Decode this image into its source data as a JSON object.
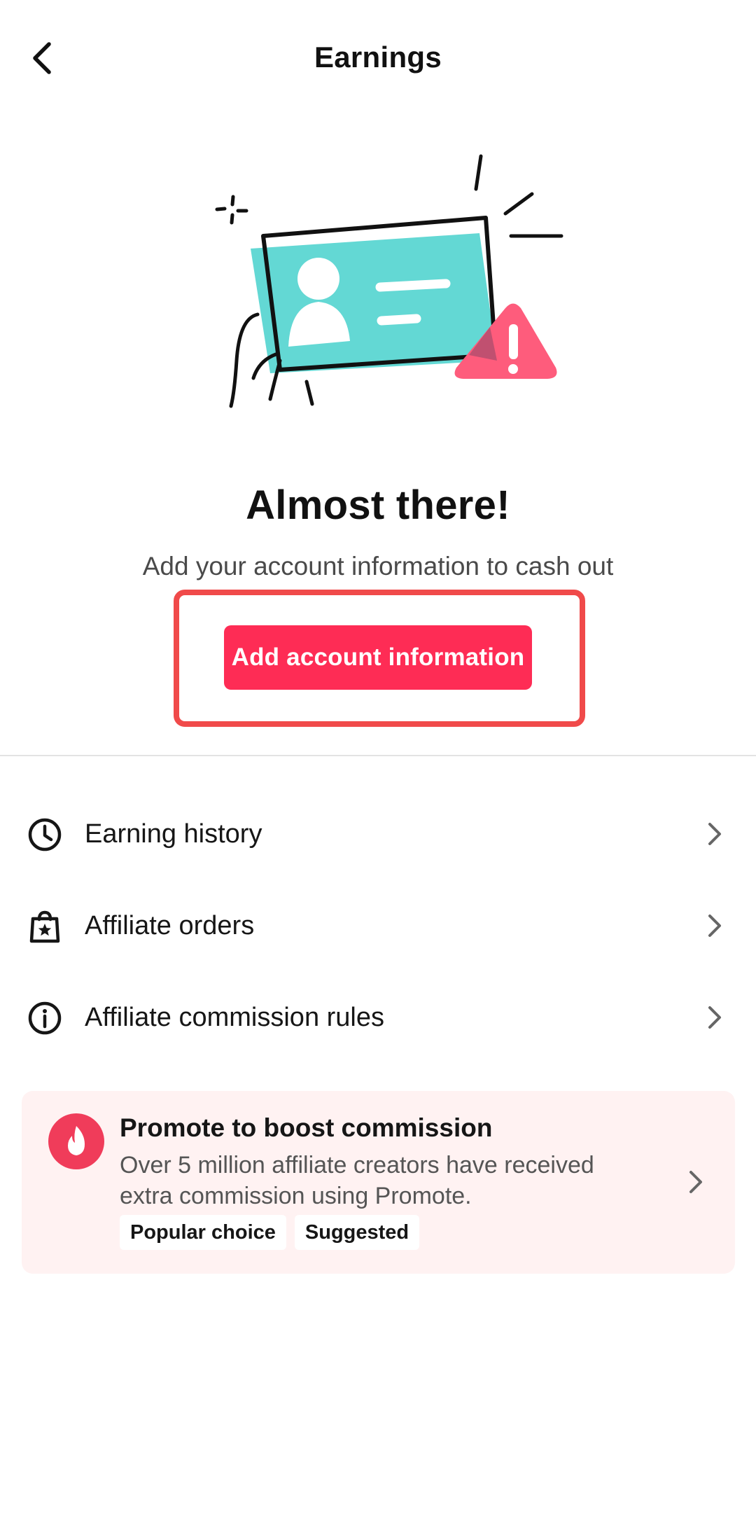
{
  "header": {
    "title": "Earnings",
    "back_icon": "chevron-left-icon"
  },
  "hero": {
    "headline": "Almost there!",
    "subtext": "Add your account information to cash out",
    "button_label": "Add account information",
    "illustration": "id-card-warning-illustration"
  },
  "menu": {
    "items": [
      {
        "label": "Earning history",
        "icon": "clock-icon"
      },
      {
        "label": "Affiliate orders",
        "icon": "shopping-bag-star-icon"
      },
      {
        "label": "Affiliate commission rules",
        "icon": "info-icon"
      }
    ]
  },
  "promo": {
    "title": "Promote to boost commission",
    "description": "Over 5 million affiliate creators have received extra commission using Promote.",
    "tags": [
      "Popular choice",
      "Suggested"
    ],
    "icon": "flame-icon"
  },
  "colors": {
    "accent": "#fe2c55",
    "highlight_border": "#f04a4a",
    "card_background": "#fff2f2",
    "illustration_teal": "#63d8d4"
  }
}
